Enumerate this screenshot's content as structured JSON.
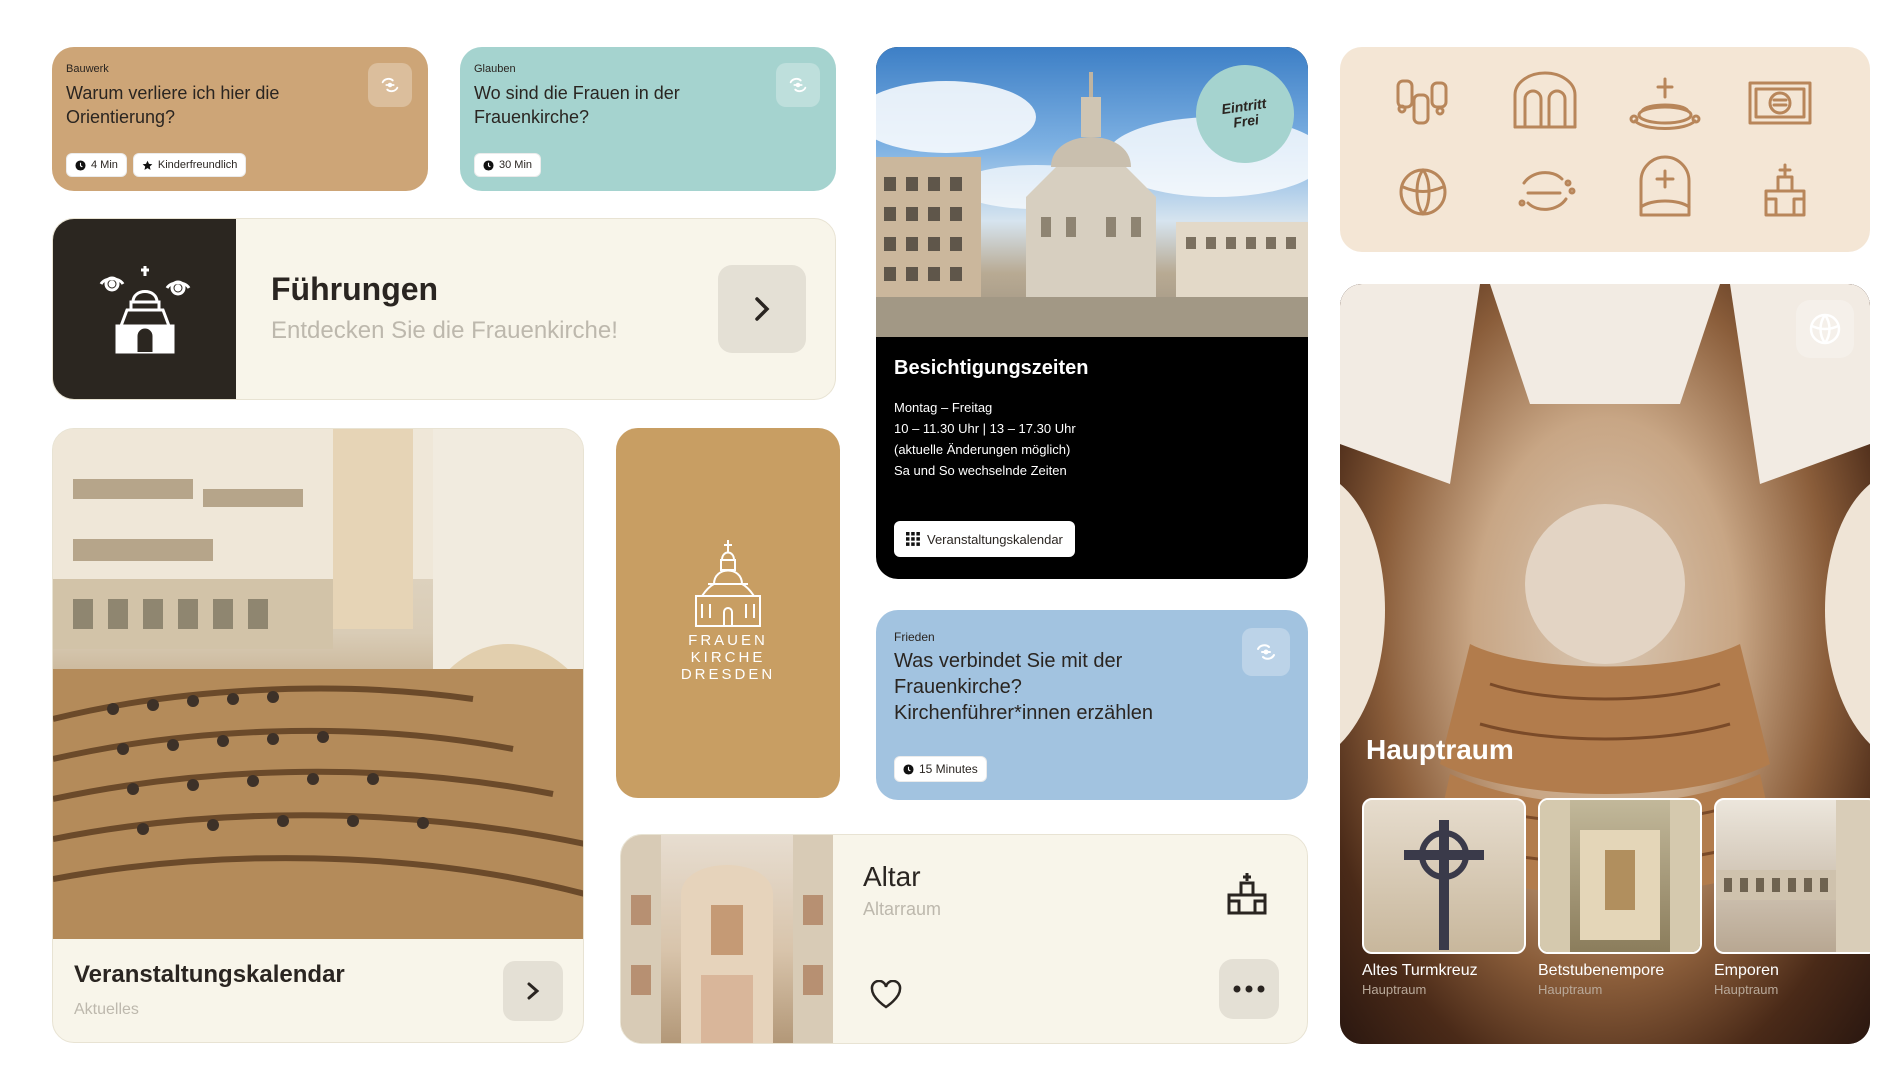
{
  "colors": {
    "tan": "#cda577",
    "teal": "#a5d3cf",
    "cream": "#f8f5ea",
    "dark": "#2b2620",
    "gold": "#c89e63",
    "sky": "#a2c3e0",
    "peach": "#f4e6d5",
    "iconbrown": "#b8865a"
  },
  "card1": {
    "category": "Bauwerk",
    "question": "Warum verliere ich hier die Orientierung?",
    "chips": [
      {
        "icon": "clock-icon",
        "label": "4 Min"
      },
      {
        "icon": "star-icon",
        "label": "Kinderfreundlich"
      }
    ],
    "icon": "swirl-icon"
  },
  "card2": {
    "category": "Glauben",
    "question": "Wo sind die Frauen in der Frauenkirche?",
    "chips": [
      {
        "icon": "clock-icon",
        "label": "30 Min"
      }
    ],
    "icon": "swirl-icon"
  },
  "tours": {
    "title": "Führungen",
    "subtitle": "Entdecken Sie die Frauenkirche!",
    "icon": "church-eyes-icon"
  },
  "visiting": {
    "badge_line1": "Eintritt",
    "badge_line2": "Frei",
    "title": "Besichtigungszeiten",
    "lines": [
      "Montag – Freitag",
      "10 – 11.30 Uhr | 13 – 17.30 Uhr",
      "(aktuelle Änderungen möglich)",
      "Sa und So wechselnde Zeiten"
    ],
    "button": "Veranstaltungskalendar"
  },
  "icons_grid": [
    "figures-icon",
    "arches-icon",
    "altar-table-icon",
    "book-icon",
    "globe-icon",
    "swirl-icon",
    "tomb-icon",
    "altar-icon"
  ],
  "logo": {
    "line1": "FRAUEN",
    "line2": "KIRCHE",
    "line3": "DRESDEN"
  },
  "events": {
    "title": "Veranstaltungskalendar",
    "subtitle": "Aktuelles"
  },
  "peace": {
    "category": "Frieden",
    "question": "Was verbindet Sie mit der Frauenkirche? Kirchenführer*innen erzählen",
    "chip": "15 Minutes"
  },
  "altar": {
    "title": "Altar",
    "subtitle": "Altarraum"
  },
  "mainroom": {
    "title": "Hauptraum",
    "items": [
      {
        "title": "Altes Turmkreuz",
        "sub": "Hauptraum"
      },
      {
        "title": "Betstubenempore",
        "sub": "Hauptraum"
      },
      {
        "title": "Emporen",
        "sub": "Hauptraum"
      }
    ]
  }
}
